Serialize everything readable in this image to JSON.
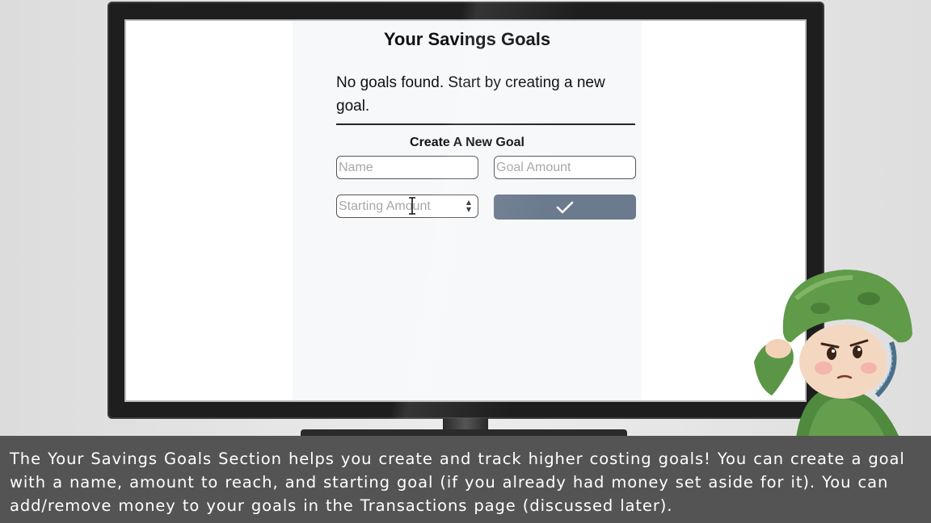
{
  "app": {
    "page_title": "Your Savings Goals",
    "empty_message": "No goals found. Start by creating a new goal.",
    "form": {
      "title": "Create A New Goal",
      "name_placeholder": "Name",
      "goal_amount_placeholder": "Goal Amount",
      "starting_amount_placeholder": "Starting Amount",
      "submit_icon": "checkmark-icon"
    },
    "colors": {
      "submit_button": "#6b7a8d",
      "panel_background": "#f6f8fa"
    }
  },
  "caption": {
    "text": "The Your Savings Goals Section helps you create and track higher costing goals! You can create a goal with a name, amount to reach, and starting goal (if you already had money set aside for it). You can add/remove money to your goals in the Transactions page (discussed later)."
  },
  "decor": {
    "mascot_icon": "soldier-salute-icon"
  }
}
